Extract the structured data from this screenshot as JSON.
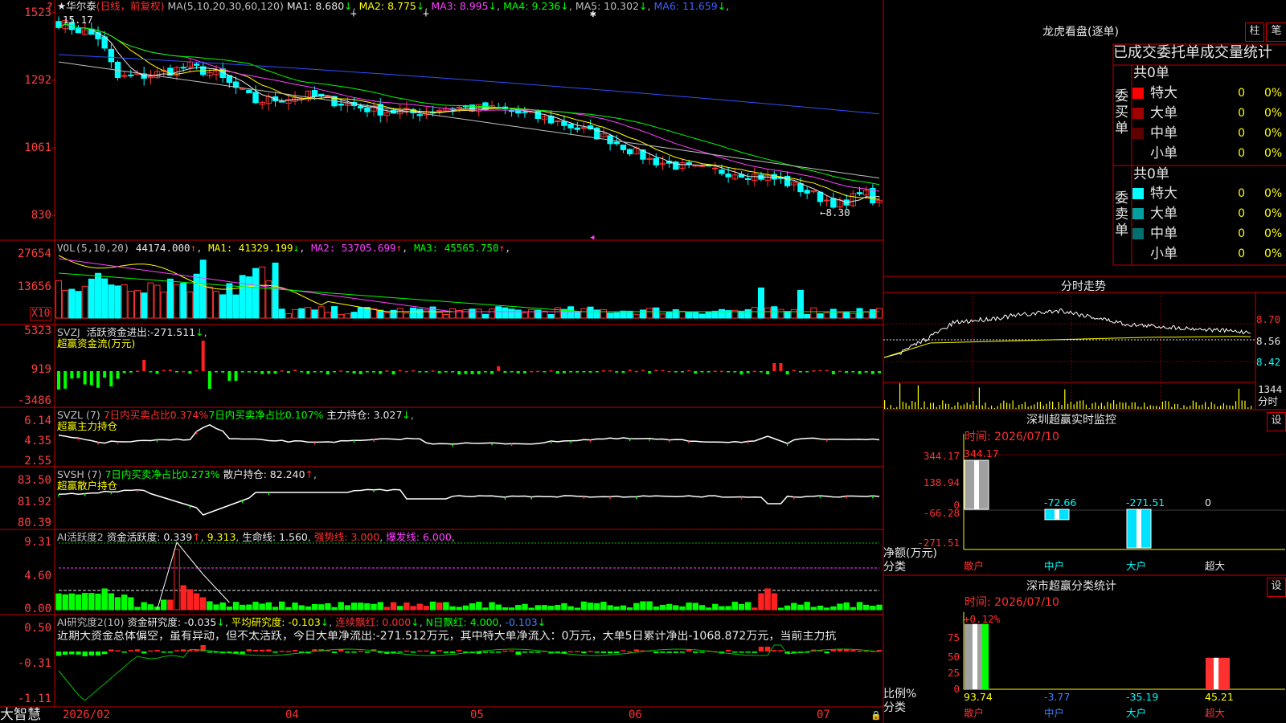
{
  "title": {
    "star": "★",
    "name": "华尔泰",
    "period": "(日线，前复权)",
    "ma_def": "MA(5,10,20,30,60,120)",
    "ma": [
      {
        "label": "MA1:",
        "value": "8.680",
        "arrow": "↓",
        "color": "#e8e8e8"
      },
      {
        "label": "MA2:",
        "value": "8.775",
        "arrow": "↓",
        "color": "#ffff00"
      },
      {
        "label": "MA3:",
        "value": "8.995",
        "arrow": "↓",
        "color": "#ff40ff"
      },
      {
        "label": "MA4:",
        "value": "9.236",
        "arrow": "↓",
        "color": "#00ff00"
      },
      {
        "label": "MA5:",
        "value": "10.302",
        "arrow": "↓",
        "color": "#c0c0c0"
      },
      {
        "label": "MA6:",
        "value": "11.659",
        "arrow": "↓",
        "color": "#4060ff"
      }
    ]
  },
  "price_axis": [
    "1523",
    "1292",
    "1061",
    "830"
  ],
  "price_high_label": "15.17",
  "price_low_label": "8.30",
  "vol": {
    "def": "VOL(5,10,20)",
    "value": "44174.000",
    "arrow": "↑",
    "ma": [
      {
        "label": "MA1:",
        "value": "41329.199",
        "arrow": "↓",
        "color": "#ffff00"
      },
      {
        "label": "MA2:",
        "value": "53705.699",
        "arrow": "↑",
        "color": "#ff40ff"
      },
      {
        "label": "MA3:",
        "value": "45565.750",
        "arrow": "↑",
        "color": "#00ff00"
      }
    ],
    "axis": [
      "27654",
      "13656"
    ],
    "unit": "X10"
  },
  "svzj": {
    "def": "SVZJ",
    "text": "活跃资金进出:",
    "value": "-271.511",
    "arrow": "↓",
    "sub": "超赢资金流(万元)",
    "axis": [
      "5323",
      "919",
      "-3486"
    ]
  },
  "svzl": {
    "def": "SVZL (7)",
    "t1": "7日内买卖占比0.374%",
    "t2": "7日内买卖净占比0.107%",
    "t3": "主力持仓:",
    "value": "3.027",
    "arrow": "↓",
    "sub": "超赢主力持仓",
    "axis": [
      "6.14",
      "4.35",
      "2.55"
    ]
  },
  "svsh": {
    "def": "SVSH (7)",
    "t1": "7日内买卖净占比0.273%",
    "t2": "散户持仓:",
    "value": "82.240",
    "arrow": "↑",
    "sub": "超赢散户持仓",
    "axis": [
      "83.50",
      "81.92",
      "80.39"
    ]
  },
  "ai1": {
    "def": "AI活跃度2",
    "t1": "资金活跃度:",
    "v1": "0.339",
    "a1": "↑",
    "v2": "9.313",
    "t2": "生命线:",
    "v3": "1.560",
    "t3": "强势线:",
    "v4": "3.000",
    "t4": "爆发线:",
    "v5": "6.000",
    "axis": [
      "9.31",
      "4.60",
      "0.00"
    ]
  },
  "ai2": {
    "def": "AI研究度2(10)",
    "t1": "资金研究度:",
    "v1": "-0.035",
    "a1": "↓",
    "t2": "平均研究度:",
    "v2": "-0.103",
    "a2": "↓",
    "t3": "连续飘红:",
    "v3": "0.000",
    "a3": "↓",
    "t4": "N日飘红:",
    "v4": "4.000",
    "v5": "-0.103",
    "a5": "↓",
    "comment": "近期大资金总体偏空，虽有异动，但不太活跃，今日大单净流出:-271.512万元，其中特大单净流入：0万元，大单5日累计净出-1068.872万元，当前主力抗",
    "axis": [
      "0.50",
      "-0.31",
      "-1.11"
    ]
  },
  "xaxis": {
    "brand": "大智慧",
    "dates": [
      "2026/02",
      "04",
      "05",
      "06",
      "07"
    ]
  },
  "lhb": {
    "title": "龙虎看盘(逐单)",
    "btn1": "柱",
    "btn2": "笔",
    "header": "已成交委托单成交量统计",
    "buy_label": "委买单",
    "sell_label": "委卖单",
    "buy_total": "共0单",
    "sell_total": "共0单",
    "buy": [
      {
        "name": "特大",
        "v": "0",
        "p": "0%",
        "color": "#ff0000"
      },
      {
        "name": "大单",
        "v": "0",
        "p": "0%",
        "color": "#a00000"
      },
      {
        "name": "中单",
        "v": "0",
        "p": "0%",
        "color": "#600000"
      },
      {
        "name": "小单",
        "v": "0",
        "p": "0%",
        "color": "#000000"
      }
    ],
    "sell": [
      {
        "name": "特大",
        "v": "0",
        "p": "0%",
        "color": "#00ffff"
      },
      {
        "name": "大单",
        "v": "0",
        "p": "0%",
        "color": "#00a0a0"
      },
      {
        "name": "中单",
        "v": "0",
        "p": "0%",
        "color": "#007070"
      },
      {
        "name": "小单",
        "v": "0",
        "p": "0%",
        "color": "#000000"
      }
    ]
  },
  "fenshi": {
    "title": "分时走势",
    "axis": [
      "8.70",
      "8.56",
      "8.42"
    ],
    "vol": "1344",
    "vol_unit": "分时"
  },
  "sz_monitor": {
    "title": "深圳超赢实时监控",
    "btn": "设",
    "time": "时间: 2026/07/10",
    "axis": [
      "344.17",
      "138.94",
      "0",
      "-66.28",
      "-271.51"
    ],
    "ylabel": "净额(万元)",
    "xlabel": "分类",
    "categories": [
      "散户",
      "中户",
      "大户",
      "超大"
    ],
    "values": [
      344.17,
      -72.66,
      -271.51,
      0
    ],
    "value_labels": [
      "344.17",
      "-72.66",
      "-271.51",
      "0"
    ]
  },
  "sz_stat": {
    "title": "深市超赢分类统计",
    "btn": "设",
    "time": "时间: 2026/07/10",
    "top_label": "+0.12%",
    "axis": [
      "75",
      "50",
      "25",
      "0"
    ],
    "ylabel": "比例%",
    "xlabel": "分类",
    "categories": [
      "散户",
      "中户",
      "大户",
      "超大"
    ],
    "values": [
      93.74,
      -3.77,
      -35.19,
      45.21
    ],
    "value_labels": [
      "93.74",
      "-3.77",
      "-35.19",
      "45.21"
    ]
  }
}
